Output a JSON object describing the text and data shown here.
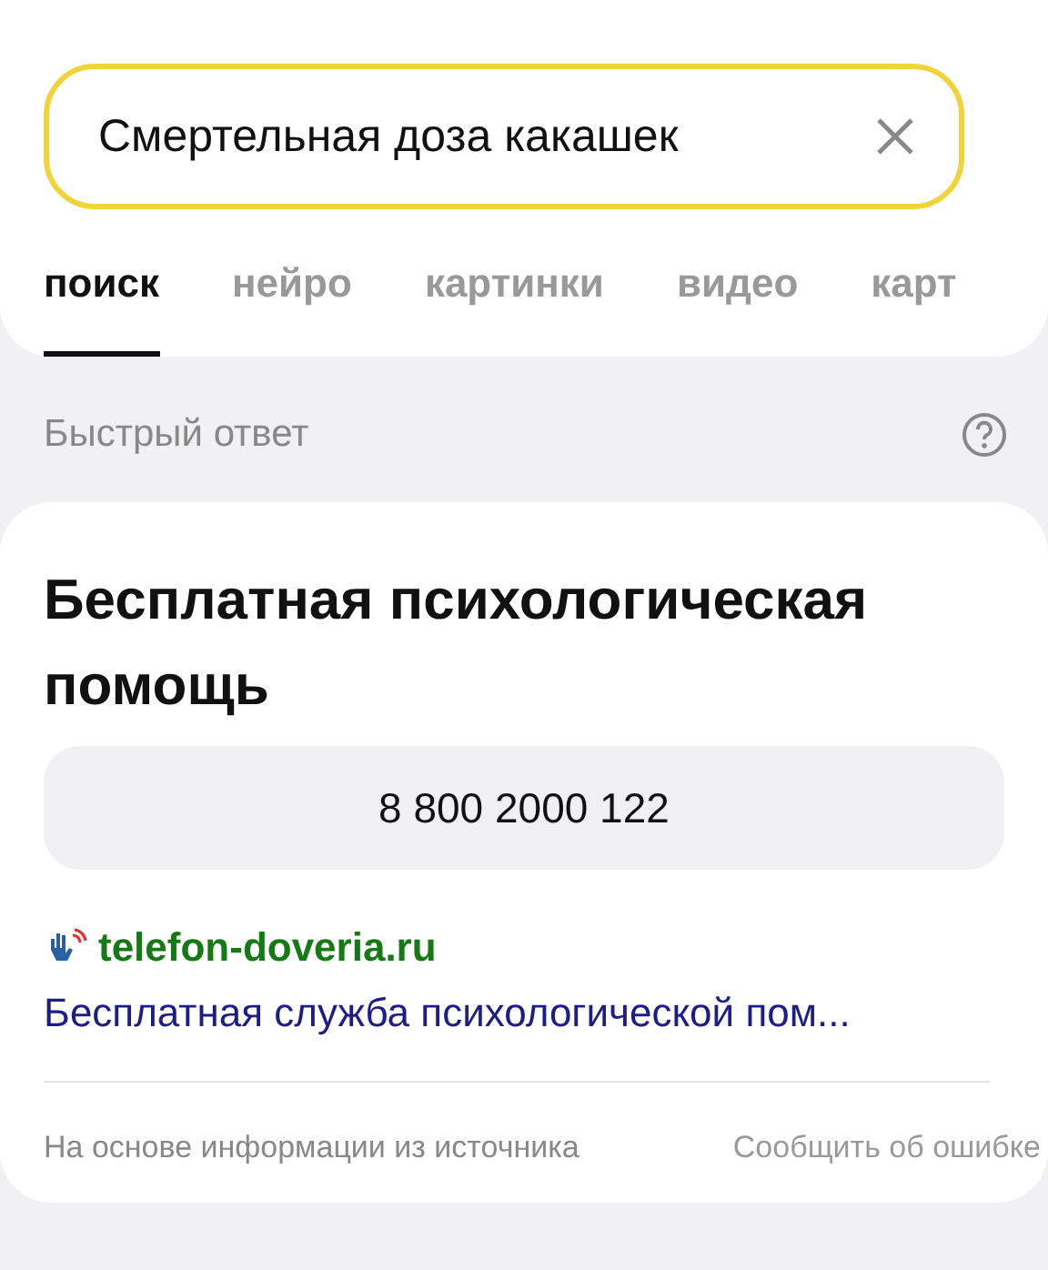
{
  "search": {
    "value": "Смертельная доза какашек"
  },
  "tabs": [
    {
      "label": "поиск",
      "selected": true
    },
    {
      "label": "нейро",
      "selected": false
    },
    {
      "label": "картинки",
      "selected": false
    },
    {
      "label": "видео",
      "selected": false
    },
    {
      "label": "карт",
      "selected": false
    }
  ],
  "quick_answer": {
    "heading": "Быстрый ответ",
    "title": "Бесплатная психологическая помощь",
    "phone": "8 800 2000 122",
    "site": "telefon-doveria.ru",
    "link": "Бесплатная служба психологической пом...",
    "source_note": "На основе информации из источника",
    "report": "Сообщить об ошибке"
  }
}
